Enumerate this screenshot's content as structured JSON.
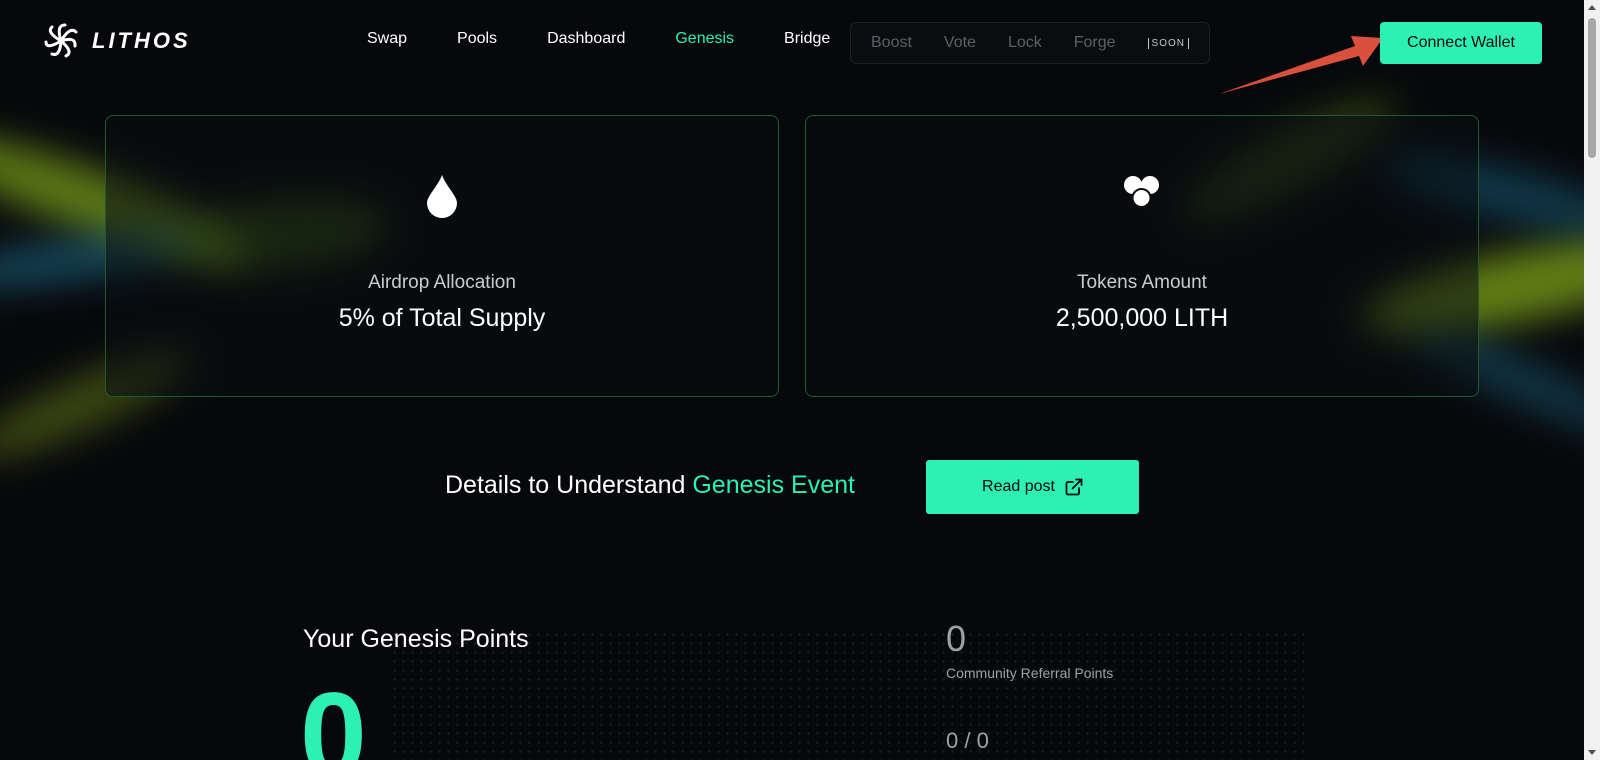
{
  "header": {
    "logo_text": "LITHOS",
    "nav": [
      {
        "label": "Swap",
        "active": false
      },
      {
        "label": "Pools",
        "active": false
      },
      {
        "label": "Dashboard",
        "active": false
      },
      {
        "label": "Genesis",
        "active": true
      },
      {
        "label": "Bridge",
        "active": false
      }
    ],
    "soon_items": [
      "Boost",
      "Vote",
      "Lock",
      "Forge"
    ],
    "soon_tag": "SOON",
    "connect_label": "Connect Wallet"
  },
  "cards": [
    {
      "icon": "droplet-icon",
      "label": "Airdrop Allocation",
      "value": "5% of Total Supply"
    },
    {
      "icon": "coins-icon",
      "label": "Tokens Amount",
      "value": "2,500,000 LITH"
    }
  ],
  "details": {
    "text": "Details to Understand ",
    "highlight": "Genesis Event",
    "read_label": "Read post"
  },
  "points": {
    "title": "Your Genesis Points",
    "total": "0",
    "referral_value": "0",
    "referral_label": "Community Referral Points",
    "ratio": "0 / 0"
  },
  "colors": {
    "accent": "#2ef0b0",
    "background": "#07080b",
    "card_border": "#1f5a30"
  }
}
